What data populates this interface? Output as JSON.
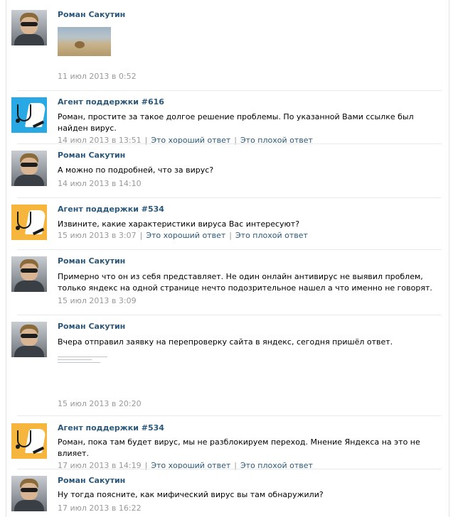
{
  "messages": [
    {
      "author": "Роман Сакутин",
      "avatar": "user-photo",
      "text": "",
      "attachment": "photo",
      "date": "11 июл 2013 в 0:52",
      "rating": false
    },
    {
      "author": "Агент поддержки #616",
      "avatar": "support-agent-blue",
      "text": "Роман, простите за такое долгое решение проблемы. По указанной Вами ссылке был найден вирус.",
      "date": "14 июл 2013 в 13:51",
      "rating": true
    },
    {
      "author": "Роман Сакутин",
      "avatar": "user-photo",
      "text": "А можно по подробней, что за вирус?",
      "date": "14 июл 2013 в 14:10",
      "rating": false
    },
    {
      "author": "Агент поддержки #534",
      "avatar": "support-agent-yellow",
      "text": "Извините, какие характеристики вируса Вас интересуют?",
      "date": "15 июл 2013 в 3:07",
      "rating": true
    },
    {
      "author": "Роман Сакутин",
      "avatar": "user-photo",
      "text": "Примерно что он из себя представляет. Не один онлайн антивирус не выявил проблем, только яндекс на одной странице нечто подозрительное нашел а что именно не говорят.",
      "date": "15 июл 2013 в 3:09",
      "rating": false
    },
    {
      "author": "Роман Сакутин",
      "avatar": "user-photo",
      "text": "Вчера отправил заявку на перепроверку сайта в яндекс, сегодня пришёл ответ.",
      "attachment": "document",
      "date": "15 июл 2013 в 20:20",
      "rating": false
    },
    {
      "author": "Агент поддержки #534",
      "avatar": "support-agent-yellow",
      "text": "Роман, пока там будет вирус, мы не разблокируем переход. Мнение Яндекса на это не влияет.",
      "date": "17 июл 2013 в 14:19",
      "rating": true
    },
    {
      "author": "Роман Сакутин",
      "avatar": "user-photo",
      "text": "Ну тогда поясните, как мифический вирус вы там обнаружили?",
      "date": "17 июл 2013 в 16:22",
      "rating": false
    }
  ],
  "rating": {
    "good": "Это хороший ответ",
    "bad": "Это плохой ответ",
    "separator": "|"
  },
  "colors": {
    "link": "#2b587a",
    "meta": "#999999",
    "agent_blue": "#29a9e3",
    "agent_yellow": "#f6b53c"
  }
}
